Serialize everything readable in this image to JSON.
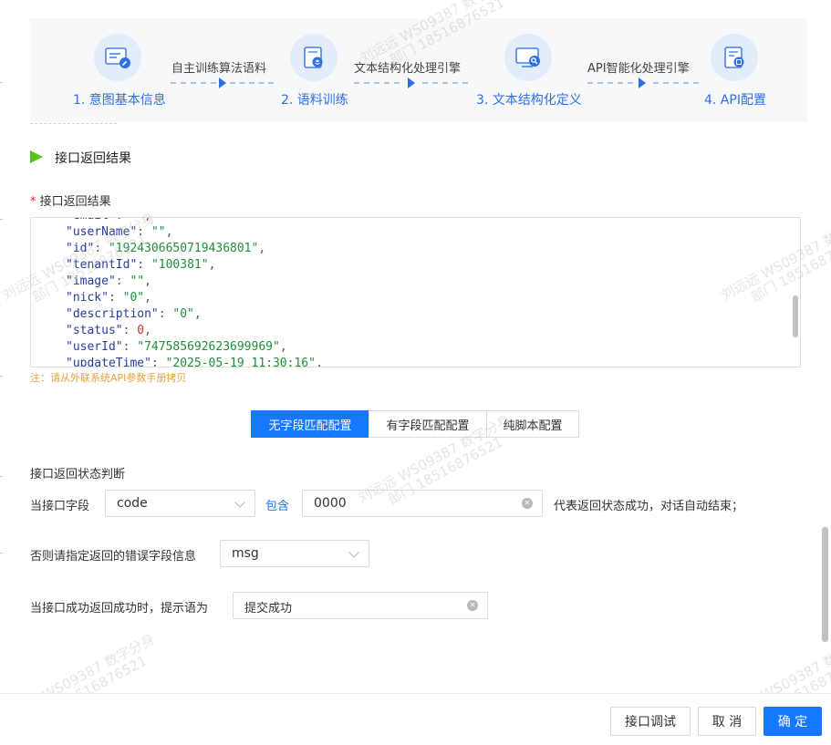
{
  "steps": [
    {
      "label": "1. 意图基本信息",
      "icon": "form-edit-icon"
    },
    {
      "label": "2. 语料训练",
      "icon": "corpus-layers-icon"
    },
    {
      "label": "3. 文本结构化定义",
      "icon": "monitor-search-icon"
    },
    {
      "label": "4. API配置",
      "icon": "api-config-icon"
    }
  ],
  "connectors": [
    "自主训练算法语料",
    "文本结构化处理引擎",
    "API智能化处理引擎"
  ],
  "section_title": "接口返回结果",
  "result_field": {
    "required_mark": "*",
    "label": "接口返回结果",
    "code_lines": [
      {
        "key": "\"email\"",
        "value": "\"\"",
        "type": "s"
      },
      {
        "key": "\"userName\"",
        "value": "\"\"",
        "type": "s"
      },
      {
        "key": "\"id\"",
        "value": "\"1924306650719436801\"",
        "type": "s"
      },
      {
        "key": "\"tenantId\"",
        "value": "\"100381\"",
        "type": "s"
      },
      {
        "key": "\"image\"",
        "value": "\"\"",
        "type": "s"
      },
      {
        "key": "\"nick\"",
        "value": "\"0\"",
        "type": "s"
      },
      {
        "key": "\"description\"",
        "value": "\"0\"",
        "type": "s"
      },
      {
        "key": "\"status\"",
        "value": "0",
        "type": "n"
      },
      {
        "key": "\"userId\"",
        "value": "\"747585692623699969\"",
        "type": "s"
      },
      {
        "key": "\"updateTime\"",
        "value": "\"2025-05-19 11:30:16\"",
        "type": "s"
      }
    ],
    "note": "注：请从外联系统API参数手册拷贝"
  },
  "config_tabs": [
    {
      "label": "无字段匹配配置",
      "active": true
    },
    {
      "label": "有字段匹配配置",
      "active": false
    },
    {
      "label": "纯脚本配置",
      "active": false
    }
  ],
  "status_section": {
    "heading": "接口返回状态判断",
    "when_field_label": "当接口字段",
    "field_select": "code",
    "contains_label": "包含",
    "contains_value": "0000",
    "success_suffix": "代表返回状态成功，对话自动结束；",
    "error_label": "否则请指定返回的错误字段信息",
    "error_select": "msg",
    "prompt_label": "当接口成功返回成功时，提示语为",
    "prompt_value": "提交成功"
  },
  "footer": {
    "debug_label": "接口调试",
    "cancel_label": "取 消",
    "confirm_label": "确 定"
  },
  "watermark": {
    "line1": "刘远远 WS09387 数字分身",
    "line2": "部门 18516876521"
  },
  "colors": {
    "primary": "#1677ff",
    "warning": "#e6a23c",
    "required": "#f5222d",
    "step_text": "#2f6fe0",
    "play": "#52c41a"
  }
}
